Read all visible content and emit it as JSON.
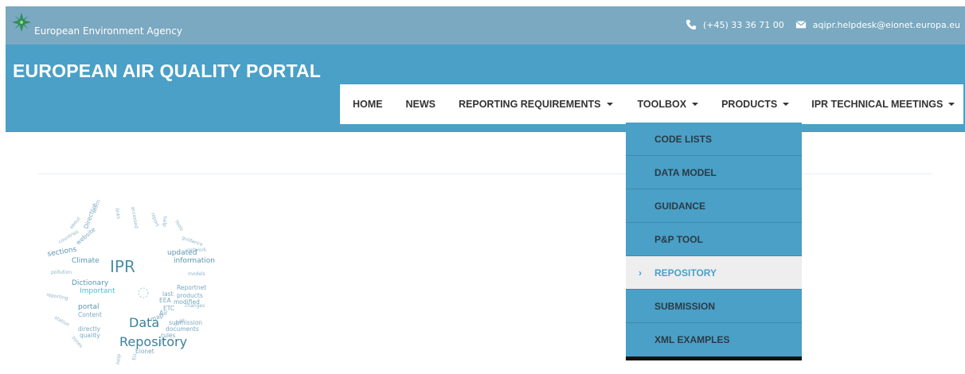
{
  "topbar": {
    "org_name": "European Environment Agency",
    "phone": "(+45) 33 36 71 00",
    "email": "aqipr.helpdesk@eionet.europa.eu"
  },
  "header": {
    "title": "EUROPEAN AIR QUALITY PORTAL"
  },
  "nav": {
    "items": [
      {
        "label": "HOME"
      },
      {
        "label": "NEWS"
      },
      {
        "label": "REPORTING REQUIREMENTS"
      },
      {
        "label": "TOOLBOX"
      },
      {
        "label": "PRODUCTS"
      },
      {
        "label": "IPR TECHNICAL MEETINGS"
      }
    ]
  },
  "dropdown": {
    "items": [
      {
        "label": "CODE LISTS"
      },
      {
        "label": "DATA MODEL"
      },
      {
        "label": "GUIDANCE"
      },
      {
        "label": "P&P TOOL"
      },
      {
        "label": "REPOSITORY"
      },
      {
        "label": "SUBMISSION"
      },
      {
        "label": "XML EXAMPLES"
      }
    ],
    "active_index": 4
  },
  "wordcloud": {
    "words": [
      "IPR",
      "Data",
      "Repository",
      "portal",
      "Dictionary",
      "Important",
      "Climate",
      "sections",
      "updated",
      "information",
      "Reportnet",
      "products",
      "modified",
      "last",
      "EEA",
      "ETC",
      "submission",
      "documents",
      "rules",
      "Air",
      "map",
      "Content",
      "directly",
      "quality",
      "Eionet"
    ]
  },
  "colors": {
    "topbar": "#7aa9c1",
    "header": "#4aa0c7",
    "dropdown": "#4aa0c7",
    "active_item_bg": "#eeeeee"
  }
}
